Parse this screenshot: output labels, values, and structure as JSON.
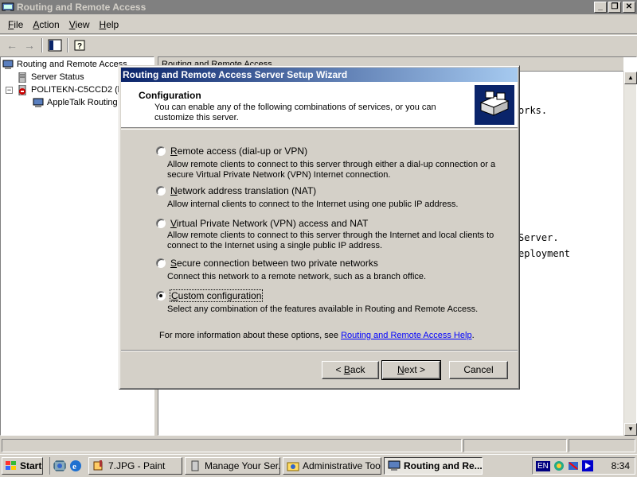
{
  "window": {
    "title": "Routing and Remote Access",
    "controls": [
      "_",
      "❐",
      "✕"
    ]
  },
  "menu": {
    "items": [
      {
        "label_u": "F",
        "label_rest": "ile"
      },
      {
        "label_u": "A",
        "label_rest": "ction"
      },
      {
        "label_u": "V",
        "label_rest": "iew"
      },
      {
        "label_u": "H",
        "label_rest": "elp"
      }
    ]
  },
  "toolbar": {
    "back": "←",
    "forward": "→"
  },
  "tree": {
    "root": "Routing and Remote Access",
    "server_status": "Server Status",
    "server": "POLITEKN-C5CCD2 (lo",
    "appletalk": "AppleTalk Routing",
    "expand_symbol": "−"
  },
  "right_pane": {
    "header": "Routing and Remote Access",
    "text_lines": [
      "orks.",
      "Server.",
      "eployment"
    ]
  },
  "wizard": {
    "title": "Routing and Remote Access Server Setup Wizard",
    "header_title": "Configuration",
    "header_subtitle": "You can enable any of the following combinations of services, or you can customize this server.",
    "options": [
      {
        "label_u": "R",
        "label_rest": "emote access (dial-up or VPN)",
        "desc": "Allow remote clients to connect to this server through either a dial-up connection or a secure Virtual Private Network (VPN) Internet connection.",
        "checked": false
      },
      {
        "label_pre": "",
        "label_u": "N",
        "label_rest": "etwork address translation (NAT)",
        "desc": "Allow internal clients to connect to the Internet using one public IP address.",
        "checked": false
      },
      {
        "label_u": "V",
        "label_rest": "irtual Private Network (VPN) access and NAT",
        "desc": "Allow remote clients to connect to this server through the Internet and local clients to connect to the Internet using a single public IP address.",
        "checked": false
      },
      {
        "label_u": "S",
        "label_rest": "ecure connection between two private networks",
        "desc": "Connect this network to a remote network, such as a branch office.",
        "checked": false
      },
      {
        "label_u": "C",
        "label_rest": "ustom configuration",
        "desc": "Select any combination of the features available in Routing and Remote Access.",
        "checked": true
      }
    ],
    "more_info_text": "For more information about these options, see ",
    "more_info_link": "Routing and Remote Access Help",
    "more_info_end": ".",
    "buttons": {
      "back_pre": "< ",
      "back_u": "B",
      "back_rest": "ack",
      "next_u": "N",
      "next_rest": "ext >",
      "cancel": "Cancel"
    }
  },
  "taskbar": {
    "start": "Start",
    "tasks": [
      {
        "label": "7.JPG - Paint",
        "active": false
      },
      {
        "label": "Manage Your Ser...",
        "active": false
      },
      {
        "label": "Administrative Tools",
        "active": false
      },
      {
        "label": "Routing and Re...",
        "active": true
      }
    ],
    "language": "EN",
    "clock": "8:34"
  }
}
